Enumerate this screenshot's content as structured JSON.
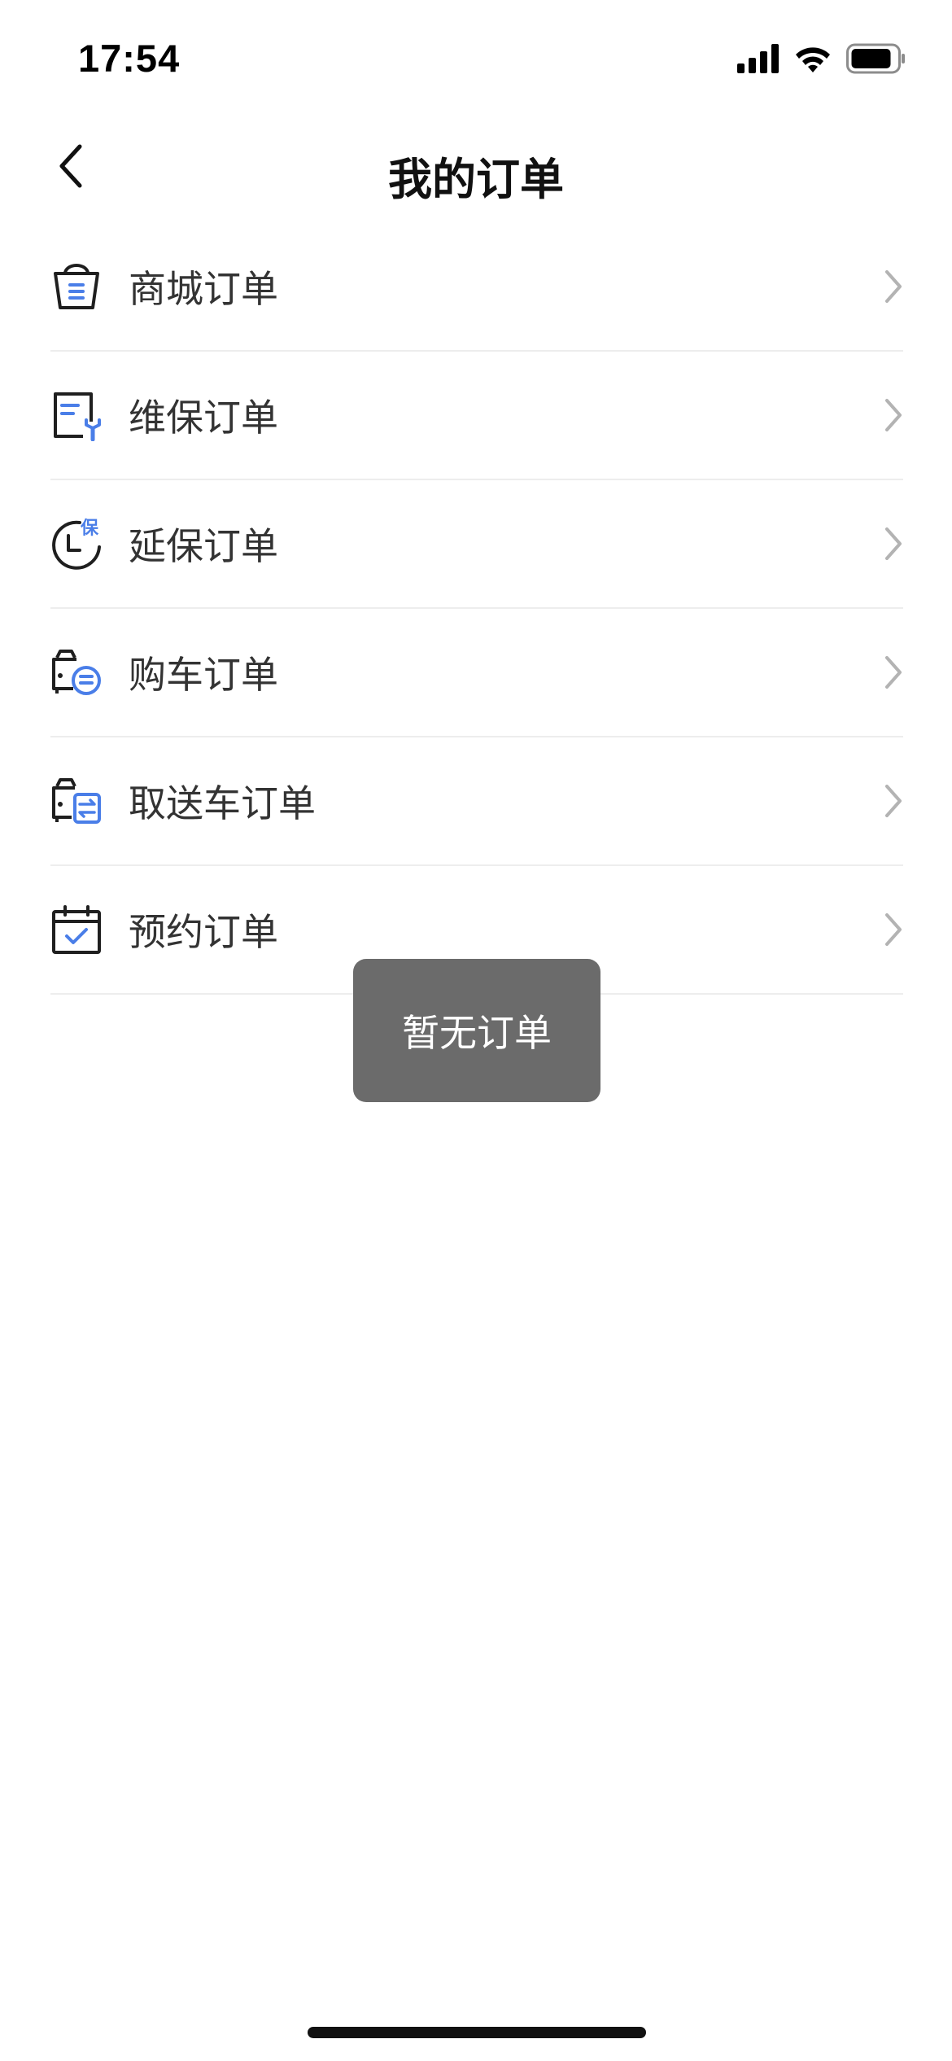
{
  "status_bar": {
    "time": "17:54",
    "icons": [
      "cellular-signal-icon",
      "wifi-icon",
      "battery-icon"
    ]
  },
  "nav": {
    "title": "我的订单",
    "back_icon": "chevron-left-icon"
  },
  "colors": {
    "accent_blue": "#4a7ee8",
    "icon_dark": "#1f1f1f",
    "chevron": "#b3b3b3",
    "divider": "#ededed",
    "toast_bg": "#6b6b6b"
  },
  "orders": [
    {
      "label": "商城订单",
      "icon": "shopping-bag-icon"
    },
    {
      "label": "维保订单",
      "icon": "maintenance-document-icon"
    },
    {
      "label": "延保订单",
      "icon": "extended-warranty-clock-icon",
      "badge": "保"
    },
    {
      "label": "购车订单",
      "icon": "car-purchase-icon"
    },
    {
      "label": "取送车订单",
      "icon": "car-pickup-delivery-icon"
    },
    {
      "label": "预约订单",
      "icon": "calendar-check-icon"
    }
  ],
  "toast": {
    "message": "暂无订单"
  }
}
